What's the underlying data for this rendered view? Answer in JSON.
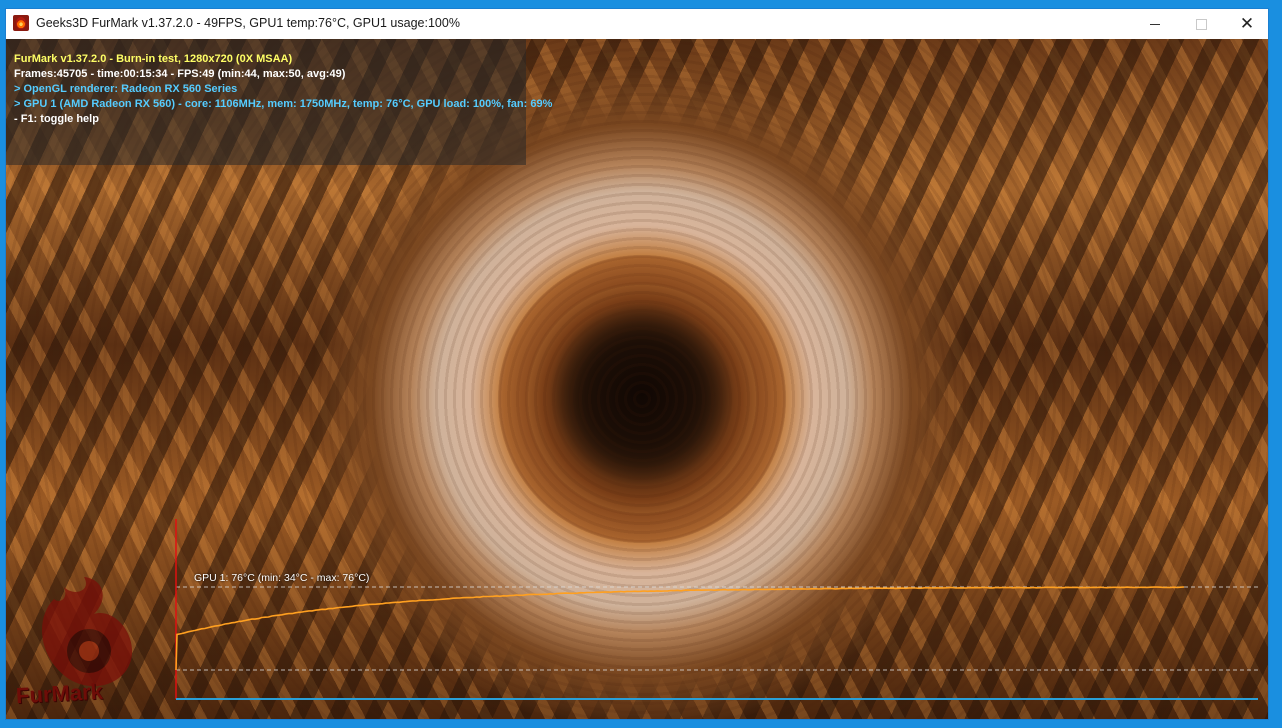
{
  "window": {
    "title": "Geeks3D FurMark v1.37.2.0 - 49FPS, GPU1 temp:76°C, GPU1 usage:100%"
  },
  "hud": {
    "line1": "FurMark v1.37.2.0 - Burn-in test, 1280x720 (0X MSAA)",
    "line2": "Frames:45705 - time:00:15:34 - FPS:49 (min:44, max:50, avg:49)",
    "line3": "> OpenGL renderer: Radeon RX 560 Series",
    "line4": "> GPU 1 (AMD Radeon RX 560) - core: 1106MHz, mem: 1750MHz, temp: 76°C, GPU load: 100%, fan: 69%",
    "line5": "- F1: toggle help",
    "colors": {
      "line1": "#ffff66",
      "line2": "#ffffff",
      "line3": "#55ccff",
      "line4": "#55ccff",
      "line5": "#ffffff"
    }
  },
  "graph": {
    "label": "GPU 1: 76°C (min: 34°C - max: 76°C)",
    "current_temp": 76,
    "min_temp": 34,
    "max_temp": 76,
    "curve_color": "#ffa020",
    "axis_color": "#2a9fd6",
    "marker_color": "#e01010"
  },
  "logo": {
    "text": "FurMark"
  }
}
